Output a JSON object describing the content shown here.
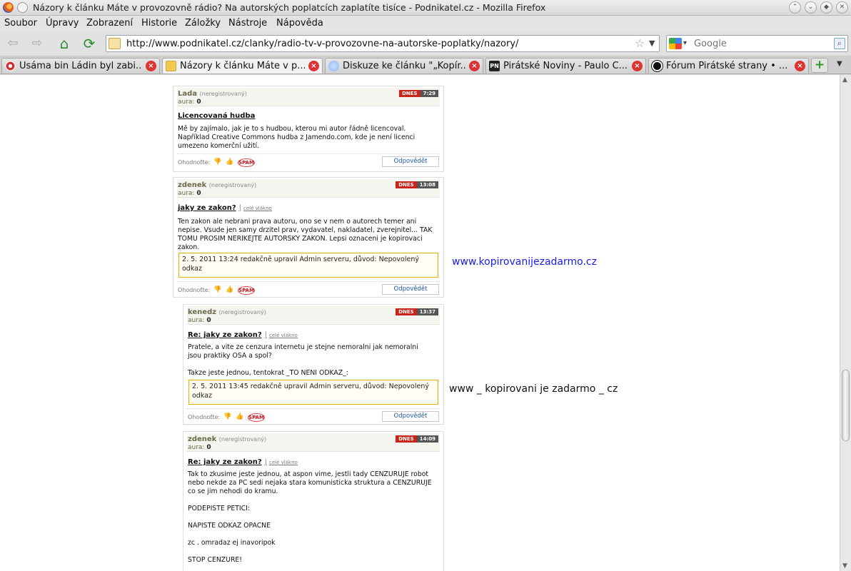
{
  "window": {
    "title": "Názory k článku Máte v provozovně rádio? Na autorských poplatcích zaplatíte tisíce - Podnikatel.cz - Mozilla Firefox"
  },
  "menu": [
    "Soubor",
    "Úpravy",
    "Zobrazení",
    "Historie",
    "Záložky",
    "Nástroje",
    "Nápověda"
  ],
  "navigation": {
    "url": "http://www.podnikatel.cz/clanky/radio-tv-v-provozovne-na-autorske-poplatky/nazory/",
    "search_placeholder": "Google"
  },
  "tabs": [
    {
      "label": "Usáma bin Ládin byl zabi...",
      "icon_color": "#d32f2f"
    },
    {
      "label": "Názory k článku Máte v p...",
      "icon_color": "#f2c94c"
    },
    {
      "label": "Diskuze ke článku \"„Kopír...",
      "icon_color": "#8ab4f8"
    },
    {
      "label": "Pirátské Noviny - Paulo C...",
      "icon_color": "#222222"
    },
    {
      "label": "Fórum Pirátské strany • ...",
      "icon_color": "#111111"
    }
  ],
  "comments": [
    {
      "author": "Lada",
      "registration": "(neregistrovaný)",
      "aura_label": "aura:",
      "aura_value": "0",
      "day": "DNES",
      "time": "7:29",
      "title": "Licencovaná hudba",
      "thread": "",
      "body": "Mě by zajímalo, jak je to s hudbou, kterou mi autor řádně licencoval.\nNapříklad Creative Commons hudba z Jamendo.com, kde je není licenci\numezeno komerční užití.",
      "edit_note": "",
      "rate_label": "Ohodnoťte:",
      "spam_label": "SPAM",
      "reply_label": "Odpovědět"
    },
    {
      "author": "zdenek",
      "registration": "(neregistrovaný)",
      "aura_label": "aura:",
      "aura_value": "0",
      "day": "DNES",
      "time": "13:08",
      "title": "jaky ze zakon?",
      "thread": "celé vlákno",
      "body": "Ten zakon ale nebrani prava autoru, ono se v nem o autorech temer ani\nnepise. Vsude jen samy drzitel prav, vydavatel, nakladatel, zverejnitel... TAK\nTOMU PROSIM NERIKEJTE AUTORSKY ZAKON. Lepsi oznaceni je kopirovaci\nzakon.",
      "edit_note": "2. 5. 2011 13:24 redakčně upravil Admin serveru, důvod: Nepovolený\nodkaz",
      "rate_label": "Ohodnoťte:",
      "spam_label": "SPAM",
      "reply_label": "Odpovědět"
    },
    {
      "author": "kenedz",
      "registration": "(neregistrovaný)",
      "aura_label": "aura:",
      "aura_value": "0",
      "day": "DNES",
      "time": "13:37",
      "title": "Re: jaky ze zakon?",
      "thread": "celé vlákno",
      "body": "Pratele, a vite ze cenzura internetu je stejne nemoralni jak nemoralni\njsou praktiky OSA a spol?\n\nTakze jeste jednou, tentokrat _TO NENI ODKAZ_:",
      "edit_note": "2. 5. 2011 13:45 redakčně upravil Admin serveru, důvod: Nepovolený\nodkaz",
      "rate_label": "Ohodnoťte:",
      "spam_label": "SPAM",
      "reply_label": "Odpovědět"
    },
    {
      "author": "zdenek",
      "registration": "(neregistrovaný)",
      "aura_label": "aura:",
      "aura_value": "0",
      "day": "DNES",
      "time": "14:09",
      "title": "Re: jaky ze zakon?",
      "thread": "celé vlákno",
      "body": "Tak to zkusime jeste jednou, at aspon vime, jestli tady CENZURUJE robot\nnebo nekde za PC sedi nejaka stara komunisticka struktura a CENZURUJE\nco se jim nehodi do kramu.\n\nPODEPISTE PETICI:\n\nNAPISTE ODKAZ OPACNE\n\nzc . omradaz ej inavoripok\n\nSTOP CENZURE!",
      "edit_note": "",
      "rate_label": "",
      "spam_label": "",
      "reply_label": ""
    }
  ],
  "overlay_links": [
    "www.kopirovanijezadarmo.cz",
    "www _ kopirovani je zadarmo _ cz"
  ]
}
